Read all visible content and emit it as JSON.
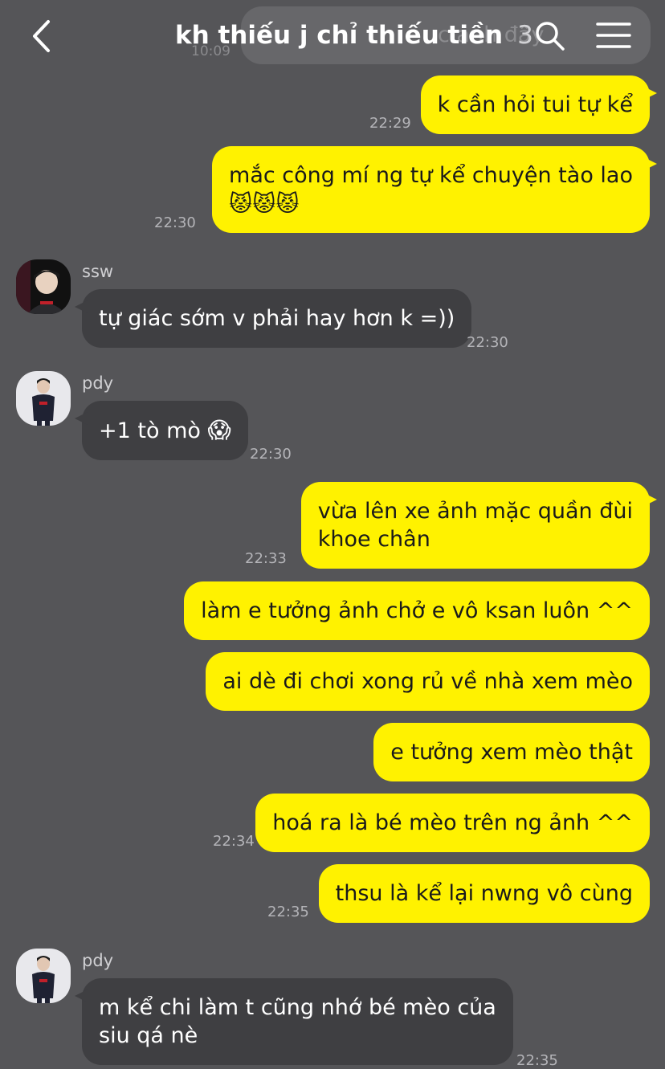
{
  "header": {
    "title": "kh thiếu j chỉ thiếu tiền",
    "member_count": "3",
    "ghost_text": "c anh đây",
    "ghost_time": "10:09"
  },
  "messages": [
    {
      "side": "me",
      "text": "k cần hỏi tui tự kể",
      "time": "22:29"
    },
    {
      "side": "me",
      "text_line1": "mắc công mí ng tự kể chuyện tào lao",
      "emoji": "😾😾😾",
      "time": "22:30"
    },
    {
      "side": "them",
      "sender": "ssw",
      "text": "tự giác sớm v phải hay hơn k =))",
      "time": "22:30"
    },
    {
      "side": "them",
      "sender": "pdy",
      "text": "+1 tò mò",
      "emoji": "😱",
      "time": "22:30"
    },
    {
      "side": "me",
      "text_line1": "vừa lên xe ảnh mặc quần đùi",
      "text_line2": "khoe chân",
      "time": "22:33"
    },
    {
      "side": "me",
      "text": "làm e tưởng ảnh chở e vô ksan luôn ^^"
    },
    {
      "side": "me",
      "text": "ai dè đi chơi xong rủ về nhà xem mèo"
    },
    {
      "side": "me",
      "text": "e tưởng xem mèo thật"
    },
    {
      "side": "me",
      "text": "hoá ra là bé mèo trên ng ảnh ^^",
      "time": "22:34"
    },
    {
      "side": "me",
      "text": "thsu là kể lại nwng vô cùng",
      "time": "22:35"
    },
    {
      "side": "them",
      "sender": "pdy",
      "text_line1": "m kể chi làm t cũng nhớ bé mèo của",
      "text_line2": "siu qá nè",
      "time": "22:35"
    }
  ],
  "colors": {
    "background": "#555558",
    "my_bubble": "#fff200",
    "their_bubble": "#3f3f42"
  },
  "icons": [
    "back-chevron",
    "search",
    "menu"
  ]
}
